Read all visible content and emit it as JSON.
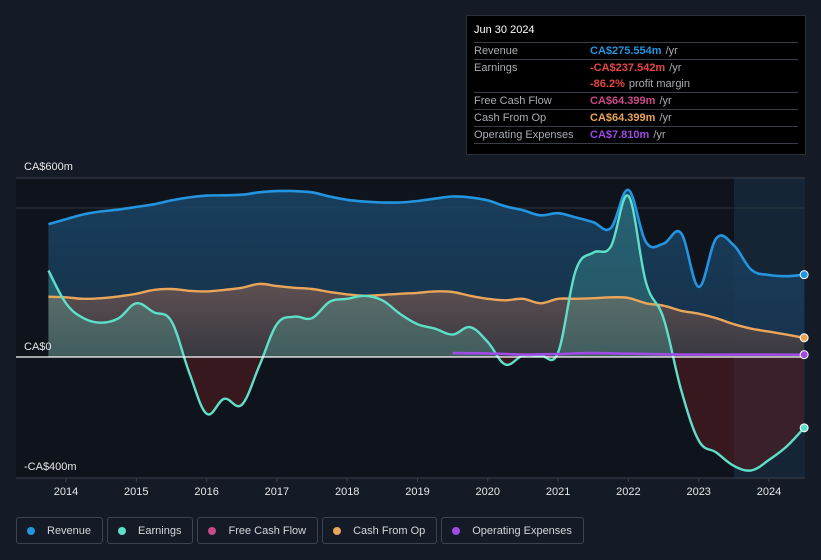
{
  "tooltip": {
    "date": "Jun 30 2024",
    "rows": [
      {
        "label": "Revenue",
        "value": "CA$275.554m",
        "unit": "/yr",
        "color": "#2394df"
      },
      {
        "label": "Earnings",
        "value": "-CA$237.542m",
        "unit": "/yr",
        "color": "#e64646"
      },
      {
        "label": "",
        "value": "-86.2%",
        "unit": "profit margin",
        "color": "#e64646"
      },
      {
        "label": "Free Cash Flow",
        "value": "CA$64.399m",
        "unit": "/yr",
        "color": "#c84a86"
      },
      {
        "label": "Cash From Op",
        "value": "CA$64.399m",
        "unit": "/yr",
        "color": "#e9a55a"
      },
      {
        "label": "Operating Expenses",
        "value": "CA$7.810m",
        "unit": "/yr",
        "color": "#9f4be4"
      }
    ]
  },
  "legend": [
    {
      "label": "Revenue",
      "color": "#2394df"
    },
    {
      "label": "Earnings",
      "color": "#5ee0c8"
    },
    {
      "label": "Free Cash Flow",
      "color": "#c84a86"
    },
    {
      "label": "Cash From Op",
      "color": "#e9a55a"
    },
    {
      "label": "Operating Expenses",
      "color": "#9f4be4"
    }
  ],
  "chart_data": {
    "type": "line",
    "title": "",
    "xlabel": "",
    "ylabel": "",
    "y_tick_labels": [
      "CA$600m",
      "CA$0",
      "-CA$400m"
    ],
    "y_ticks": [
      600,
      0,
      -400
    ],
    "ylim": [
      -400,
      600
    ],
    "xlim": [
      2013.25,
      2024.55
    ],
    "x_ticks": [
      2014,
      2015,
      2016,
      2017,
      2018,
      2019,
      2020,
      2021,
      2022,
      2023,
      2024
    ],
    "x_tick_labels": [
      "2014",
      "2015",
      "2016",
      "2017",
      "2018",
      "2019",
      "2020",
      "2021",
      "2022",
      "2023",
      "2024"
    ],
    "grid": true,
    "legend_position": "bottom",
    "forecast_shade_from": 2023.5,
    "series": [
      {
        "name": "Revenue",
        "color": "#2394df",
        "x": [
          2013.75,
          2014.0,
          2014.25,
          2014.5,
          2014.75,
          2015.0,
          2015.25,
          2015.5,
          2015.75,
          2016.0,
          2016.25,
          2016.5,
          2016.75,
          2017.0,
          2017.25,
          2017.5,
          2017.75,
          2018.0,
          2018.25,
          2018.5,
          2018.75,
          2019.0,
          2019.25,
          2019.5,
          2019.75,
          2020.0,
          2020.25,
          2020.5,
          2020.75,
          2021.0,
          2021.25,
          2021.5,
          2021.75,
          2022.0,
          2022.25,
          2022.5,
          2022.75,
          2023.0,
          2023.25,
          2023.5,
          2023.75,
          2024.0,
          2024.25,
          2024.5
        ],
        "values": [
          445,
          462,
          478,
          488,
          494,
          503,
          512,
          525,
          535,
          541,
          542,
          544,
          552,
          556,
          556,
          552,
          538,
          527,
          521,
          518,
          518,
          523,
          531,
          538,
          535,
          525,
          505,
          492,
          475,
          482,
          468,
          452,
          432,
          560,
          385,
          380,
          415,
          235,
          398,
          374,
          292,
          275,
          271,
          276
        ]
      },
      {
        "name": "Earnings",
        "color": "#5ee0c8",
        "x": [
          2013.75,
          2014.0,
          2014.25,
          2014.5,
          2014.75,
          2015.0,
          2015.25,
          2015.5,
          2015.75,
          2016.0,
          2016.25,
          2016.5,
          2016.75,
          2017.0,
          2017.25,
          2017.5,
          2017.75,
          2018.0,
          2018.25,
          2018.5,
          2018.75,
          2019.0,
          2019.25,
          2019.5,
          2019.75,
          2020.0,
          2020.25,
          2020.5,
          2020.75,
          2021.0,
          2021.25,
          2021.5,
          2021.75,
          2022.0,
          2022.25,
          2022.5,
          2022.75,
          2023.0,
          2023.25,
          2023.5,
          2023.75,
          2024.0,
          2024.25,
          2024.5
        ],
        "values": [
          290,
          180,
          130,
          115,
          130,
          180,
          150,
          120,
          -50,
          -190,
          -140,
          -160,
          -30,
          110,
          135,
          130,
          185,
          195,
          205,
          190,
          145,
          110,
          95,
          75,
          100,
          50,
          -25,
          5,
          5,
          15,
          290,
          350,
          370,
          540,
          250,
          130,
          -110,
          -280,
          -320,
          -365,
          -380,
          -345,
          -300,
          -237.5
        ]
      },
      {
        "name": "Free Cash Flow",
        "color": "#c84a86",
        "x": [
          2013.75,
          2024.5
        ],
        "values": [
          null,
          64.4
        ],
        "note": "line not separately visible; FCF coincides with Cash From Op in shaded area"
      },
      {
        "name": "Cash From Op",
        "color": "#e9a55a",
        "x": [
          2013.75,
          2014.0,
          2014.25,
          2014.5,
          2014.75,
          2015.0,
          2015.25,
          2015.5,
          2015.75,
          2016.0,
          2016.25,
          2016.5,
          2016.75,
          2017.0,
          2017.25,
          2017.5,
          2017.75,
          2018.0,
          2018.25,
          2018.5,
          2018.75,
          2019.0,
          2019.25,
          2019.5,
          2019.75,
          2020.0,
          2020.25,
          2020.5,
          2020.75,
          2021.0,
          2021.25,
          2021.5,
          2021.75,
          2022.0,
          2022.25,
          2022.5,
          2022.75,
          2023.0,
          2023.25,
          2023.5,
          2023.75,
          2024.0,
          2024.25,
          2024.5
        ],
        "values": [
          202,
          200,
          195,
          197,
          203,
          212,
          225,
          228,
          222,
          220,
          225,
          232,
          245,
          238,
          232,
          228,
          218,
          210,
          205,
          208,
          212,
          215,
          220,
          218,
          205,
          195,
          190,
          195,
          180,
          195,
          195,
          197,
          200,
          198,
          180,
          172,
          155,
          145,
          130,
          110,
          95,
          85,
          75,
          64.4
        ]
      },
      {
        "name": "Operating Expenses",
        "color": "#9f4be4",
        "x": [
          2019.5,
          2020.0,
          2020.5,
          2021.0,
          2021.5,
          2022.0,
          2022.5,
          2023.0,
          2023.5,
          2024.0,
          2024.5
        ],
        "values": [
          13,
          12,
          8,
          10,
          13,
          11,
          9,
          8,
          8,
          8,
          7.8
        ]
      }
    ]
  }
}
